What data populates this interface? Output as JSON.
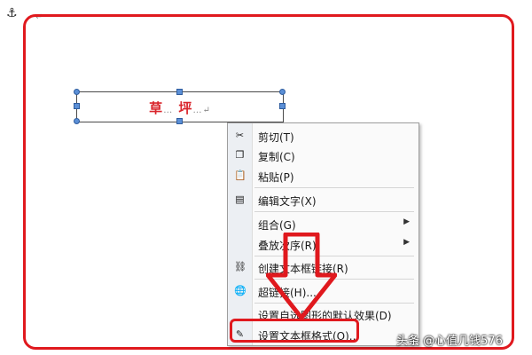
{
  "page": {
    "anchor_symbol": "⚓",
    "paragraph_mark": "↵"
  },
  "textbox": {
    "chars": [
      "草",
      "坪"
    ],
    "dots": "…",
    "end_mark": "↵"
  },
  "context_menu": {
    "items": [
      {
        "label": "剪切(T)",
        "icon": "scissors-icon",
        "glyph": "✂",
        "submenu": false
      },
      {
        "label": "复制(C)",
        "icon": "copy-icon",
        "glyph": "❐",
        "submenu": false
      },
      {
        "label": "粘贴(P)",
        "icon": "paste-icon",
        "glyph": "📋",
        "submenu": false
      },
      {
        "label": "编辑文字(X)",
        "icon": "edit-text-icon",
        "glyph": "▤",
        "submenu": false
      },
      {
        "label": "组合(G)",
        "icon": "",
        "glyph": "",
        "submenu": true
      },
      {
        "label": "叠放次序(R)",
        "icon": "",
        "glyph": "",
        "submenu": true
      },
      {
        "label": "创建文本框链接(R)",
        "icon": "link-chain-icon",
        "glyph": "⛓",
        "submenu": false
      },
      {
        "label": "超链接(H)...",
        "icon": "globe-link-icon",
        "glyph": "🌐",
        "submenu": false
      },
      {
        "label": "设置自选图形的默认效果(D)",
        "icon": "",
        "glyph": "",
        "submenu": false
      },
      {
        "label": "设置文本框格式(O)...",
        "icon": "format-textbox-icon",
        "glyph": "✎",
        "submenu": false
      }
    ],
    "submenu_arrow": "▶"
  },
  "colors": {
    "annotation_red": "#e0191e",
    "handle_blue": "#5b8fd6",
    "textbox_text": "#d9252c"
  },
  "watermark": {
    "text": "头条 @心值几钱576"
  }
}
